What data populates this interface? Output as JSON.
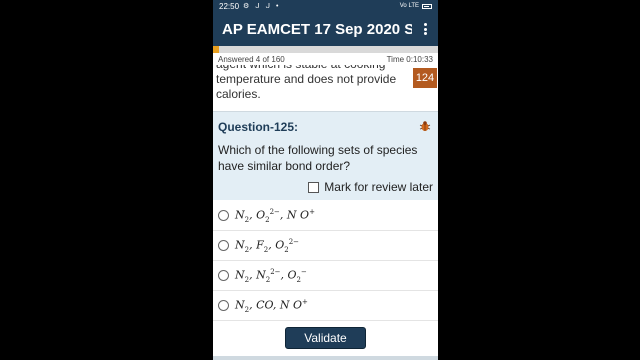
{
  "status_bar": {
    "time": "22:50",
    "icons": "⚙ ᒍ ᒍ •",
    "signal_text": "Vo LTE"
  },
  "app_bar": {
    "title": "AP EAMCET 17 Sep 2020 S...",
    "menu_icon": "more-vert-icon"
  },
  "progress": {
    "answered_text": "Answered 4 of 160",
    "time_text": "Time 0:10:33",
    "fill_fraction": 0.025,
    "fill_color": "#e8a020"
  },
  "previous_question": {
    "text": "agent which is stable at cooking temperature and does not provide calories.",
    "number_badge": "124",
    "badge_color": "#b35a1f"
  },
  "question": {
    "title": "Question-125:",
    "text": "Which of the following sets of species have similar bond order?",
    "review_label": "Mark for review later",
    "bug_icon": "bug-report-icon"
  },
  "options": [
    {
      "parts": [
        [
          "N",
          "2",
          "",
          ", "
        ],
        [
          "O",
          "2",
          "2−",
          ", "
        ],
        [
          "N O",
          "",
          "+",
          ""
        ]
      ]
    },
    {
      "parts": [
        [
          "N",
          "2",
          "",
          ", "
        ],
        [
          "F",
          "2",
          "",
          ", "
        ],
        [
          "O",
          "2",
          "2−",
          ""
        ]
      ]
    },
    {
      "parts": [
        [
          "N",
          "2",
          "",
          ", "
        ],
        [
          "N",
          "2",
          "2−",
          ", "
        ],
        [
          "O",
          "2",
          "−",
          ""
        ]
      ]
    },
    {
      "parts": [
        [
          "N",
          "2",
          "",
          ", "
        ],
        [
          "CO",
          "",
          "",
          ", "
        ],
        [
          "N O",
          "",
          "+",
          ""
        ]
      ]
    }
  ],
  "footer": {
    "validate_label": "Validate"
  },
  "colors": {
    "primary": "#1f3d58",
    "card_bg": "#e3eef5"
  }
}
